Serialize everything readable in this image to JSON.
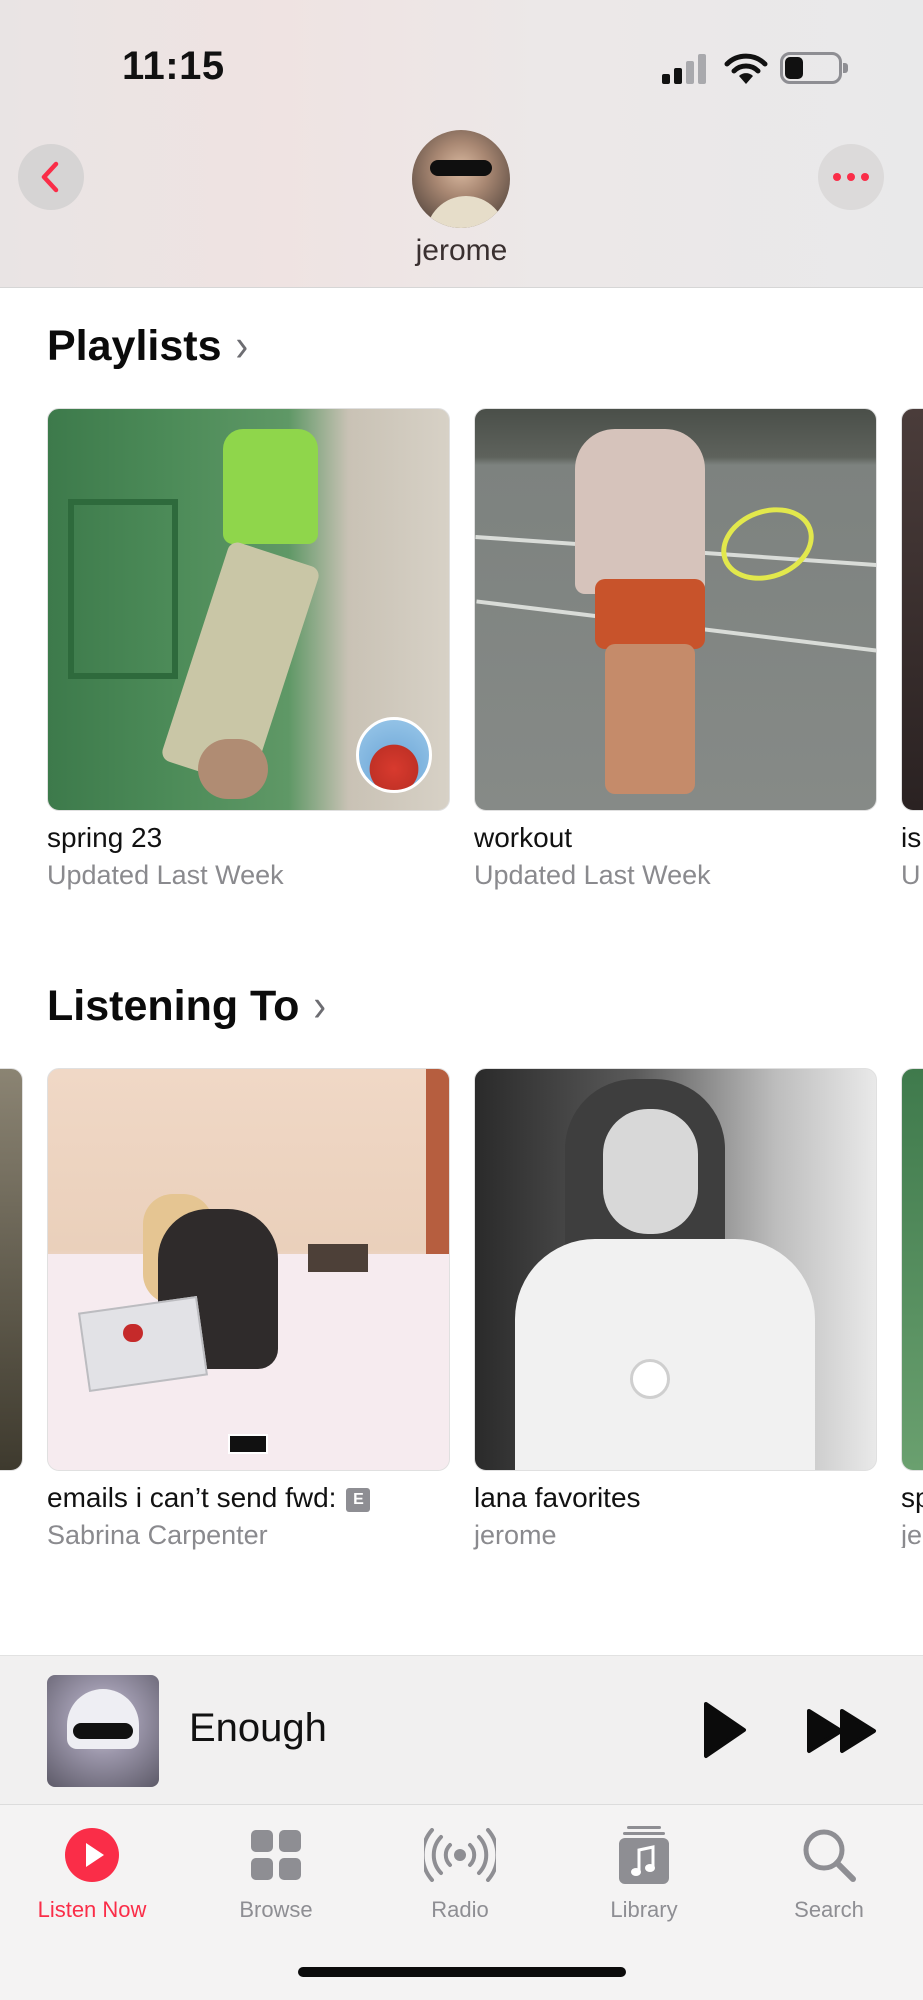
{
  "status_bar": {
    "time": "11:15",
    "signal_icon": "cellular-signal-icon",
    "wifi_icon": "wifi-icon",
    "battery_icon": "battery-icon",
    "battery_level": 0.35
  },
  "header": {
    "back_icon": "chevron-left-icon",
    "more_icon": "ellipsis-icon",
    "username": "jerome"
  },
  "sections": {
    "playlists": {
      "title": "Playlists",
      "items": [
        {
          "title": "spring 23",
          "subtitle": "Updated Last Week"
        },
        {
          "title": "workout",
          "subtitle": "Updated Last Week"
        },
        {
          "title": "is",
          "subtitle": "U"
        }
      ]
    },
    "listening_to": {
      "title": "Listening To",
      "items": [
        {
          "title": "emails i can’t send fwd:",
          "explicit_badge": "E",
          "subtitle": "Sabrina Carpenter"
        },
        {
          "title": "lana favorites",
          "subtitle": "jerome"
        },
        {
          "title": "sp",
          "subtitle": "je"
        }
      ]
    }
  },
  "mini_player": {
    "title": "Enough",
    "play_icon": "play-icon",
    "forward_icon": "fast-forward-icon"
  },
  "tabbar": {
    "tabs": [
      {
        "label": "Listen Now",
        "icon": "listen-now-icon",
        "active": true
      },
      {
        "label": "Browse",
        "icon": "browse-grid-icon",
        "active": false
      },
      {
        "label": "Radio",
        "icon": "radio-icon",
        "active": false
      },
      {
        "label": "Library",
        "icon": "library-icon",
        "active": false
      },
      {
        "label": "Search",
        "icon": "search-icon",
        "active": false
      }
    ]
  },
  "colors": {
    "accent": "#fa2d48",
    "secondary_text": "#8a8a8e",
    "inactive_tab": "#8e8e93"
  }
}
